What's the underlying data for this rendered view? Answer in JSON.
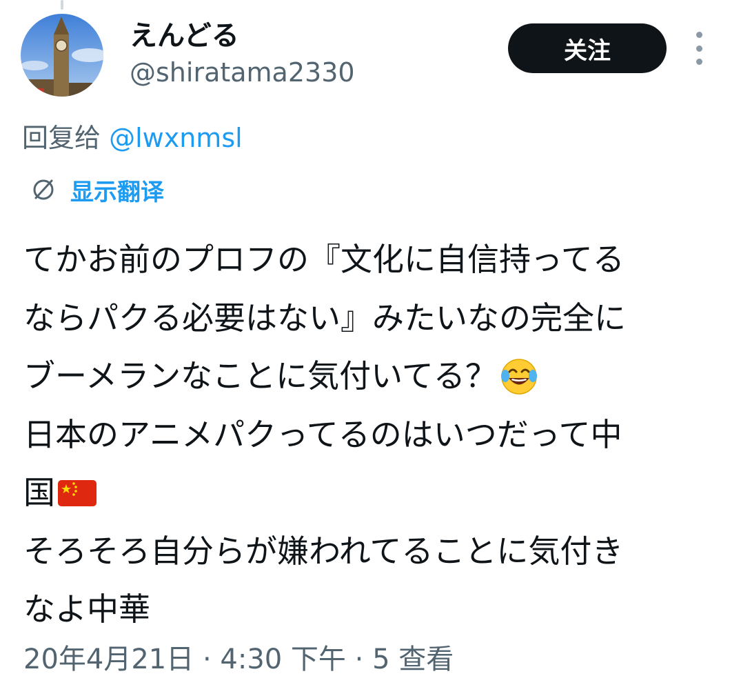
{
  "author": {
    "display_name": "えんどる",
    "handle": "@shiratama2330"
  },
  "follow_button": {
    "label": "关注"
  },
  "more_icon": "more-vertical-icon",
  "reply": {
    "prefix": "回复给 ",
    "mention": "@lwxnmsl"
  },
  "translate": {
    "label": "显示翻译",
    "icon": "translate-globe-icon"
  },
  "tweet": {
    "lines": [
      {
        "text": "てかお前のプロフの『文化に自信持ってる"
      },
      {
        "text": "ならパクる必要はない』みたいなの完全に"
      },
      {
        "text": "ブーメランなことに気付いてる？",
        "emoji": "face-with-tears-of-joy"
      },
      {
        "text": "日本のアニメパクってるのはいつだって中"
      },
      {
        "text": "国",
        "emoji": "china-flag"
      },
      {
        "text": "そろそろ自分らが嫌われてることに気付き"
      },
      {
        "text": "なよ中華"
      }
    ]
  },
  "timestamp_partial": "20年4月21日 · 4:30 下午 · 5 查看",
  "colors": {
    "text_primary": "#0f1419",
    "text_secondary": "#536471",
    "link": "#1d9bf0",
    "button_bg": "#0f1419"
  }
}
